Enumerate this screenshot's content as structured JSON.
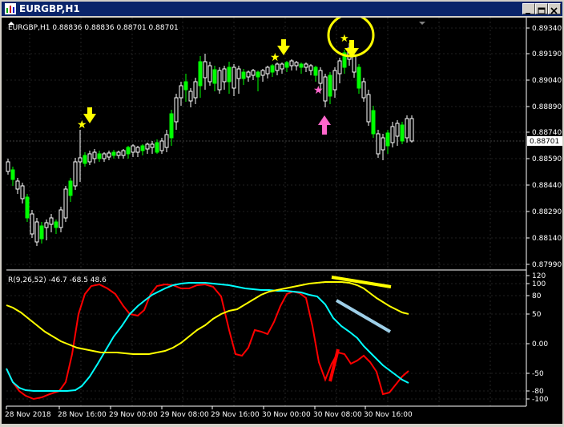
{
  "window": {
    "title": "EURGBP,H1",
    "buttons": [
      "minimize-button",
      "maximize-button",
      "close-button"
    ]
  },
  "main_chart": {
    "info": "EURGBP,H1  0.88836 0.88836 0.88701 0.88701",
    "current_price_label": "0.88701",
    "price_axis": [
      "0.89340",
      "0.89190",
      "0.89040",
      "0.88890",
      "0.88740",
      "0.88590",
      "0.88440",
      "0.88290",
      "0.88140",
      "0.87990"
    ],
    "colors": {
      "bull": "#ffffff",
      "bear": "#00ff00",
      "background": "#000000"
    }
  },
  "indicator": {
    "label": "R(9,26,52) -46.7 -68.5 48.6",
    "axis": [
      "120",
      "100",
      "80",
      "50",
      "0.00",
      "-50",
      "-80",
      "-100"
    ]
  },
  "time_axis": [
    "28 Nov 2018",
    "28 Nov 16:00",
    "29 Nov 00:00",
    "29 Nov 08:00",
    "29 Nov 16:00",
    "30 Nov 00:00",
    "30 Nov 08:00",
    "30 Nov 16:00"
  ],
  "chart_data": {
    "type": "line",
    "series": [
      {
        "name": "",
        "color": "#ff0000"
      },
      {
        "name": "",
        "color": "#00ffff"
      },
      {
        "name": "",
        "color": "#ffff00"
      }
    ],
    "ylim": [
      -100,
      120
    ]
  }
}
